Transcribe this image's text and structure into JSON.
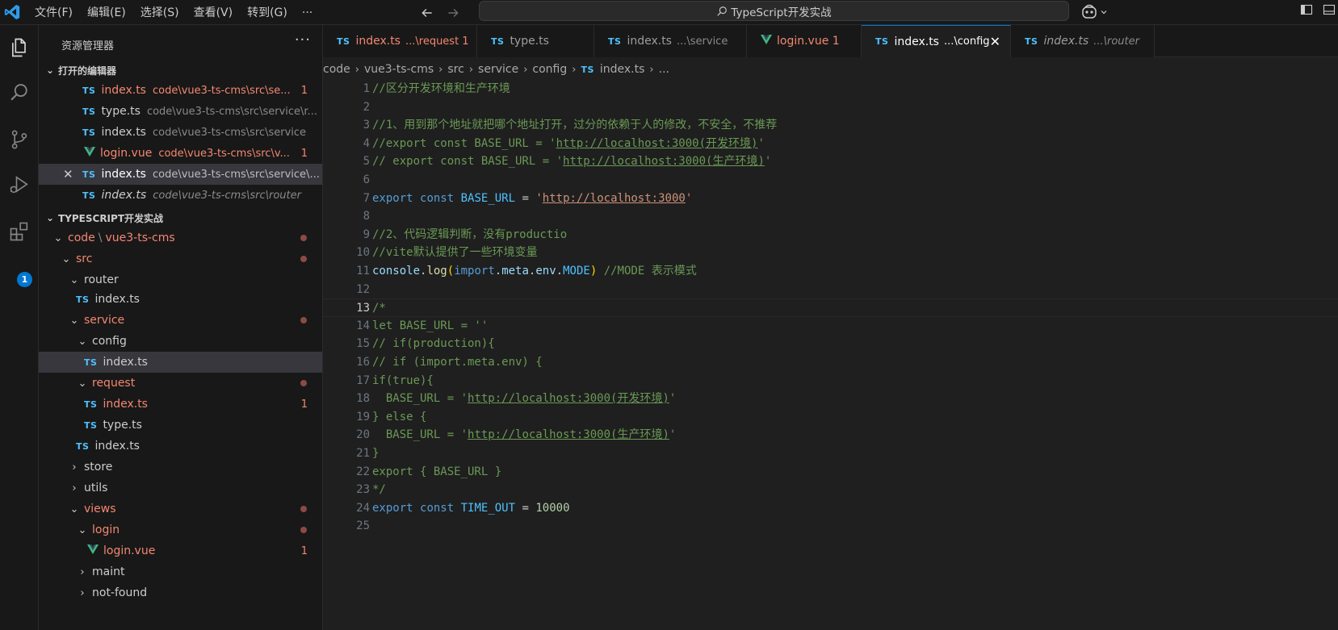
{
  "titlebar": {
    "menu": [
      "文件(F)",
      "编辑(E)",
      "选择(S)",
      "查看(V)",
      "转到(G)"
    ],
    "more": "···",
    "search_text": "TypeScript开发实战"
  },
  "activity": {
    "extensions_badge": "1"
  },
  "sidebar": {
    "title": "资源管理器",
    "more": "···",
    "open_editors_title": "打开的编辑器",
    "open_editors": [
      {
        "badge": "TS",
        "name": "index.ts",
        "path": "code\\vue3-ts-cms\\src\\se...",
        "count": "1"
      },
      {
        "badge": "TS",
        "name": "type.ts",
        "path": "code\\vue3-ts-cms\\src\\service\\r...",
        "count": ""
      },
      {
        "badge": "TS",
        "name": "index.ts",
        "path": "code\\vue3-ts-cms\\src\\service",
        "count": ""
      },
      {
        "badge": "V",
        "name": "login.vue",
        "path": "code\\vue3-ts-cms\\src\\v...",
        "count": "1"
      },
      {
        "badge": "TS",
        "name": "index.ts",
        "path": "code\\vue3-ts-cms\\src\\service\\...",
        "count": ""
      },
      {
        "badge": "TS",
        "name": "index.ts",
        "path": "code\\vue3-ts-cms\\src\\router",
        "count": ""
      }
    ],
    "workspace_title": "TYPESCRIPT开发实战",
    "tree": {
      "code": "code",
      "project": "vue3-ts-cms",
      "src": "src",
      "router": "router",
      "router_index": "index.ts",
      "service": "service",
      "config": "config",
      "config_index": "index.ts",
      "request": "request",
      "request_index": "index.ts",
      "request_index_count": "1",
      "type": "type.ts",
      "service_index": "index.ts",
      "store": "store",
      "utils": "utils",
      "views": "views",
      "login": "login",
      "login_vue": "login.vue",
      "login_vue_count": "1",
      "maint": "maint",
      "not_found": "not-found"
    }
  },
  "tabs": [
    {
      "badge": "TS",
      "name": "index.ts",
      "desc": "...\\request 1"
    },
    {
      "badge": "TS",
      "name": "type.ts",
      "desc": ""
    },
    {
      "badge": "TS",
      "name": "index.ts",
      "desc": "...\\service"
    },
    {
      "badge": "V",
      "name": "login.vue 1",
      "desc": ""
    },
    {
      "badge": "TS",
      "name": "index.ts",
      "desc": "...\\config"
    },
    {
      "badge": "TS",
      "name": "index.ts",
      "desc": "...\\router"
    }
  ],
  "breadcrumb": {
    "parts": [
      "code",
      "vue3-ts-cms",
      "src",
      "service",
      "config"
    ],
    "file_badge": "TS",
    "file": "index.ts",
    "tail": "..."
  },
  "editor": {
    "line_numbers": [
      "1",
      "2",
      "3",
      "4",
      "5",
      "6",
      "7",
      "8",
      "9",
      "10",
      "11",
      "12",
      "13",
      "14",
      "15",
      "16",
      "17",
      "18",
      "19",
      "20",
      "21",
      "22",
      "23",
      "24",
      "25"
    ],
    "current_line": "13"
  },
  "colors": {
    "accent": "#0078d4",
    "error": "#f48771",
    "comment": "#6a9955",
    "keyword": "#569cd6",
    "string": "#ce9178",
    "number": "#b5cea8"
  }
}
